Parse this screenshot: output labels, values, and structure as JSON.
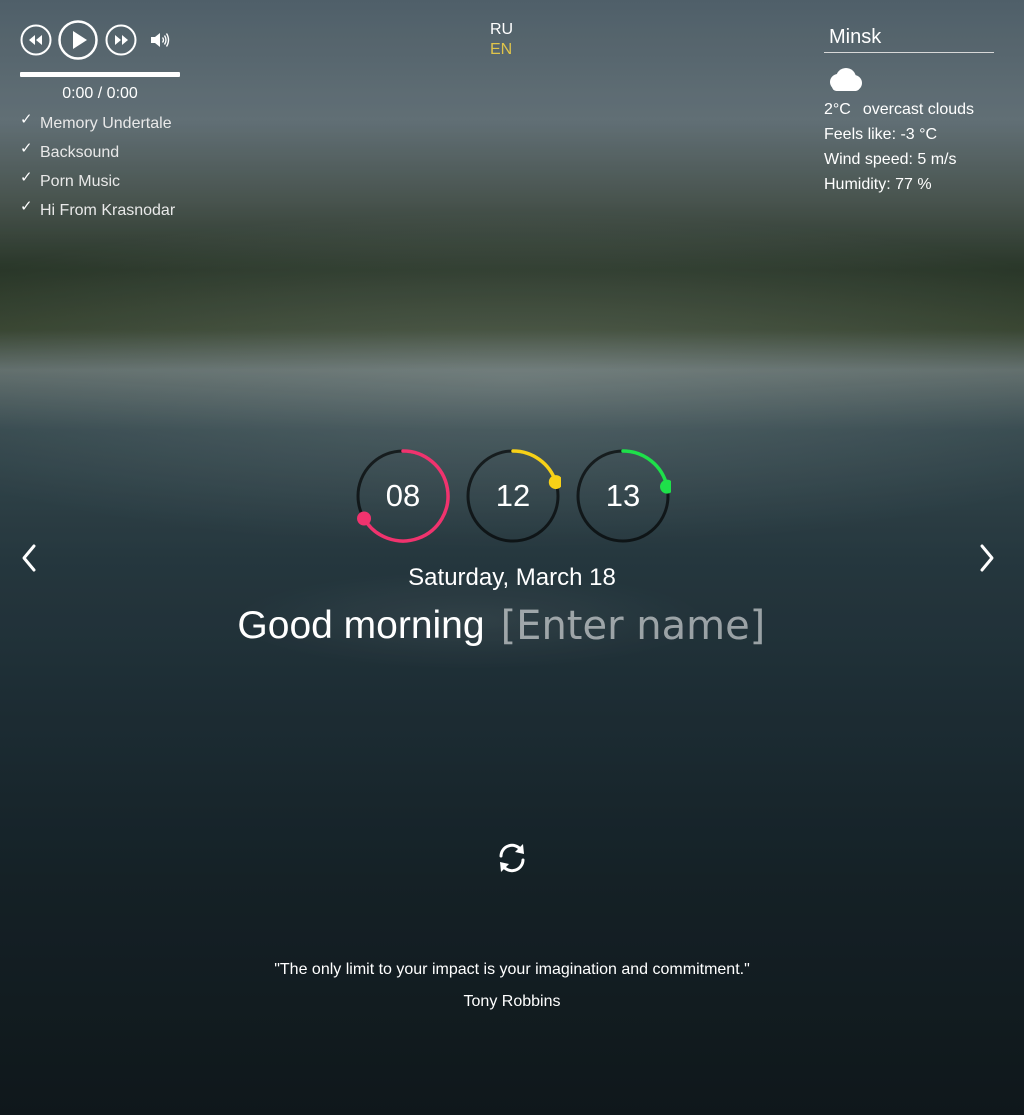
{
  "player": {
    "time": "0:00 / 0:00",
    "progress": 0,
    "playlist": [
      "Memory Undertale",
      "Backsound",
      "Porn Music",
      "Hi From Krasnodar"
    ],
    "check_glyph": "✓"
  },
  "language": {
    "options": [
      "RU",
      "EN"
    ],
    "active": "EN",
    "active_color": "#e0c44a"
  },
  "weather": {
    "city": "Minsk",
    "icon": "overcast-clouds-icon",
    "temperature": "2°C",
    "description": "overcast clouds",
    "feels_like": "Feels like: -3 °C",
    "wind": "Wind speed: 5 m/s",
    "humidity": "Humidity: 77 %"
  },
  "clock": {
    "hours": "08",
    "minutes": "12",
    "seconds": "13",
    "colors": {
      "hours": "#f0336e",
      "minutes": "#f7d117",
      "seconds": "#1ee04a"
    }
  },
  "date": "Saturday, March 18",
  "greeting": {
    "text": "Good morning",
    "placeholder": "[Enter name]"
  },
  "quote": {
    "text": "\"The only limit to your impact is your imagination and commitment.\"",
    "author": "Tony Robbins"
  }
}
